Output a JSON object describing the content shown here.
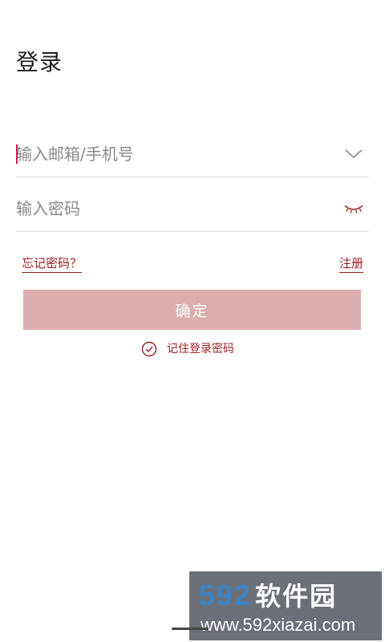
{
  "header": {
    "title": "登录"
  },
  "form": {
    "account_placeholder": "输入邮箱/手机号",
    "account_value": "",
    "password_placeholder": "输入密码",
    "password_value": "",
    "forgot_password_label": "忘记密码？",
    "register_label": "注册",
    "submit_label": "确定",
    "remember_password_label": "记住登录密码"
  },
  "icons": {
    "account_dropdown": "chevron-down-icon",
    "password_toggle": "eye-closed-icon",
    "remember_check": "check-circle-icon"
  },
  "colors": {
    "accent": "#9a1f1f",
    "caret": "#c2185b",
    "button_bg": "#dbaeae",
    "divider": "#e3e3e3"
  },
  "watermark": {
    "logo_digits": "592",
    "logo_text": "软件园",
    "url": "www.592xiazai.com"
  }
}
